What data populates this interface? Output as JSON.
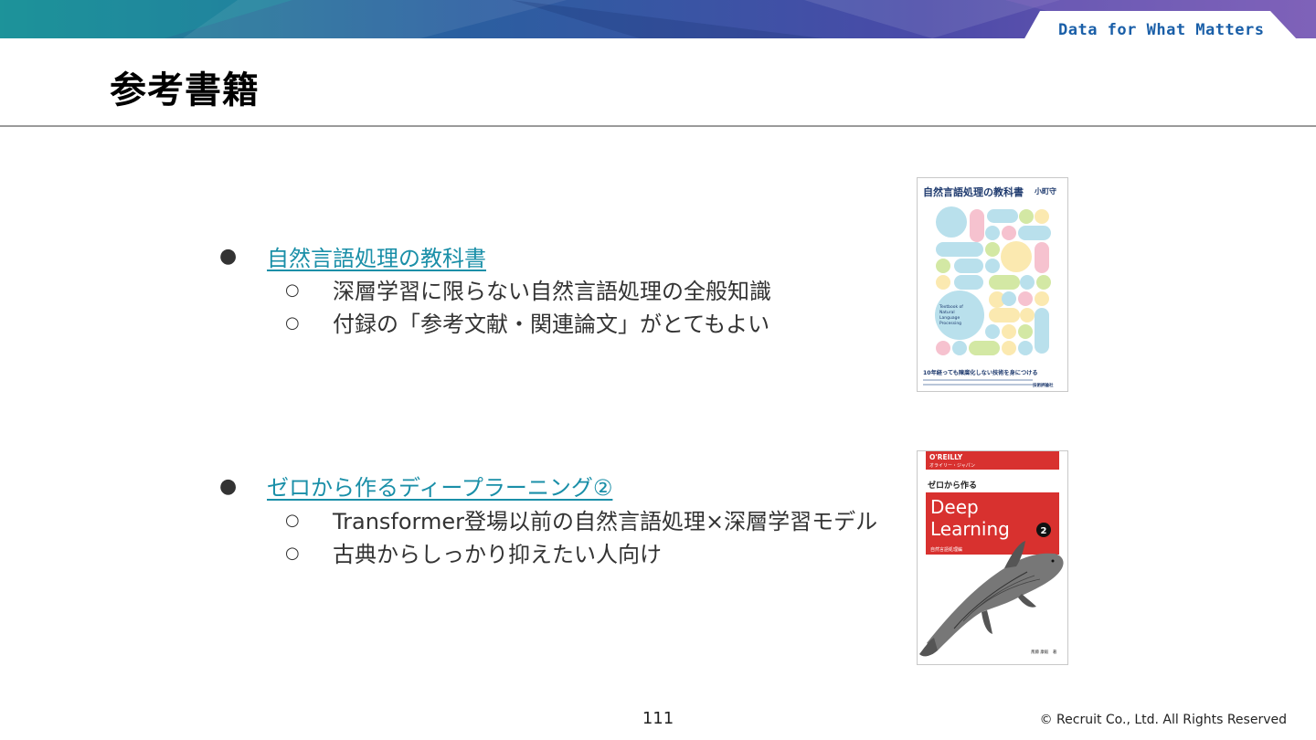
{
  "header": {
    "tagline": "Data for What Matters"
  },
  "page": {
    "title": "参考書籍",
    "number": "111",
    "copyright": "© Recruit Co., Ltd. All Rights Reserved"
  },
  "books": [
    {
      "bullet": "●",
      "link_text": "自然言語処理の教科書",
      "points": [
        {
          "marker": "○",
          "text": "深層学習に限らない自然言語処理の全般知識"
        },
        {
          "marker": "○",
          "text": "付録の「参考文献・関連論文」がとてもよい"
        }
      ],
      "cover": {
        "title": "自然言語処理の教科書",
        "author": "小町守",
        "english_title": "Textbook of Natural Language Processing",
        "subtitle": "10年経っても陳腐化しない技術を身につける",
        "publisher": "技術評論社"
      }
    },
    {
      "bullet": "●",
      "link_text": "ゼロから作るディープラーニング②",
      "points": [
        {
          "marker": "○",
          "text": "Transformer登場以前の自然言語処理×深層学習モデル"
        },
        {
          "marker": "○",
          "text": "古典からしっかり抑えたい人向け"
        }
      ],
      "cover": {
        "brand": "O'REILLY",
        "brand_jp": "オライリー・ジャパン",
        "pre_title": "ゼロから作る",
        "title_line1": "Deep",
        "title_line2": "Learning",
        "volume": "2",
        "subtitle": "自然言語処理編",
        "author": "斎藤 康毅　著"
      }
    }
  ]
}
